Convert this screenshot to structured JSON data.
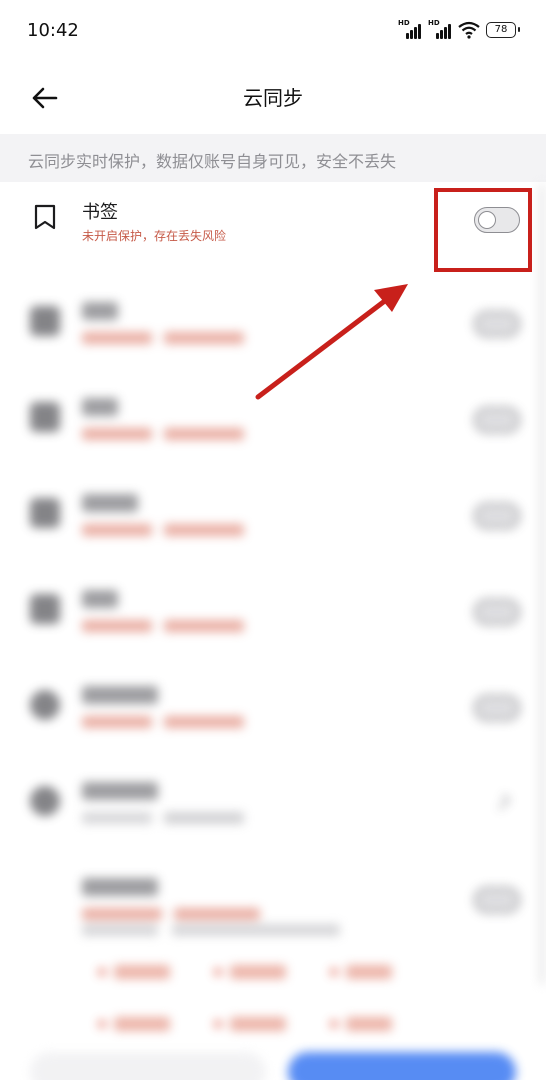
{
  "status_bar": {
    "time": "10:42",
    "signal_label_1": "HD",
    "signal_label_2": "HD",
    "battery": "78"
  },
  "nav": {
    "title": "云同步",
    "back_icon": "arrow-left-icon"
  },
  "banner": {
    "text": "云同步实时保护，数据仅账号自身可见，安全不丢失"
  },
  "rows": [
    {
      "title": "书签",
      "subtitle": "未开启保护，存在丢失风险",
      "icon": "bookmark-icon",
      "toggle_on": false
    }
  ],
  "colors": {
    "warning_text": "#c65a48",
    "annotation_red": "#c8201b",
    "primary_blue": "#3a78f2"
  }
}
